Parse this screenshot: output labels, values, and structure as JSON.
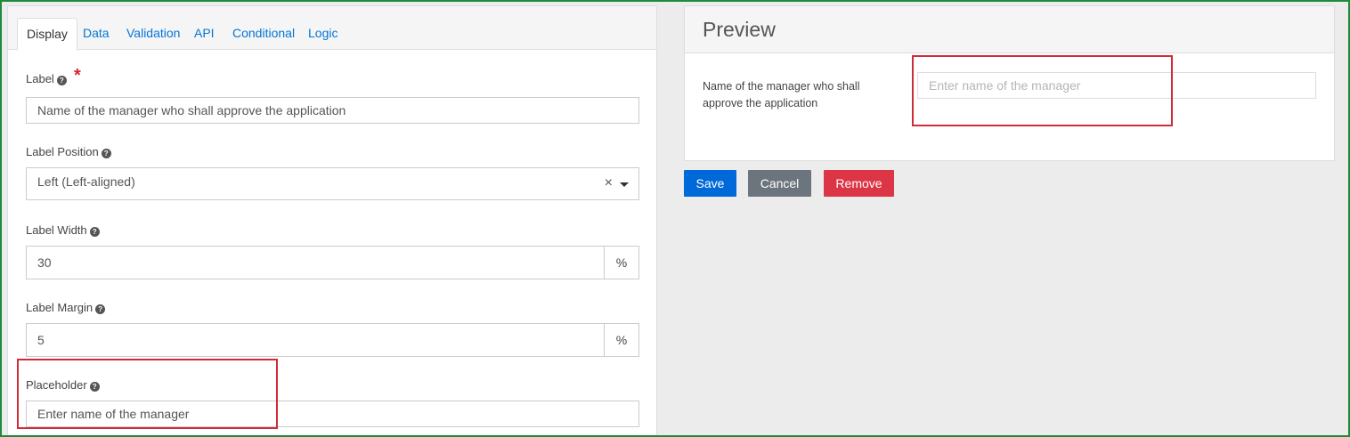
{
  "tabs": [
    "Display",
    "Data",
    "Validation",
    "API",
    "Conditional",
    "Logic"
  ],
  "fields": {
    "label": {
      "title": "Label",
      "value": "Name of the manager who shall approve the application",
      "required_marker": "*"
    },
    "label_position": {
      "title": "Label Position",
      "value": "Left (Left-aligned)",
      "clear": "×"
    },
    "label_width": {
      "title": "Label Width",
      "value": "30",
      "unit": "%"
    },
    "label_margin": {
      "title": "Label Margin",
      "value": "5",
      "unit": "%"
    },
    "placeholder": {
      "title": "Placeholder",
      "value": "Enter name of the manager"
    }
  },
  "help_icon": "?",
  "preview": {
    "title": "Preview",
    "label": "Name of the manager who shall approve the application",
    "input_placeholder": "Enter name of the manager"
  },
  "buttons": {
    "save": "Save",
    "cancel": "Cancel",
    "remove": "Remove"
  },
  "colors": {
    "tab_link": "#0275d8",
    "required": "#d9262e",
    "save": "#0069d9",
    "cancel": "#6c757d",
    "remove": "#dc3545",
    "highlight": "#d12b3a",
    "frame": "#1e8a3c"
  }
}
